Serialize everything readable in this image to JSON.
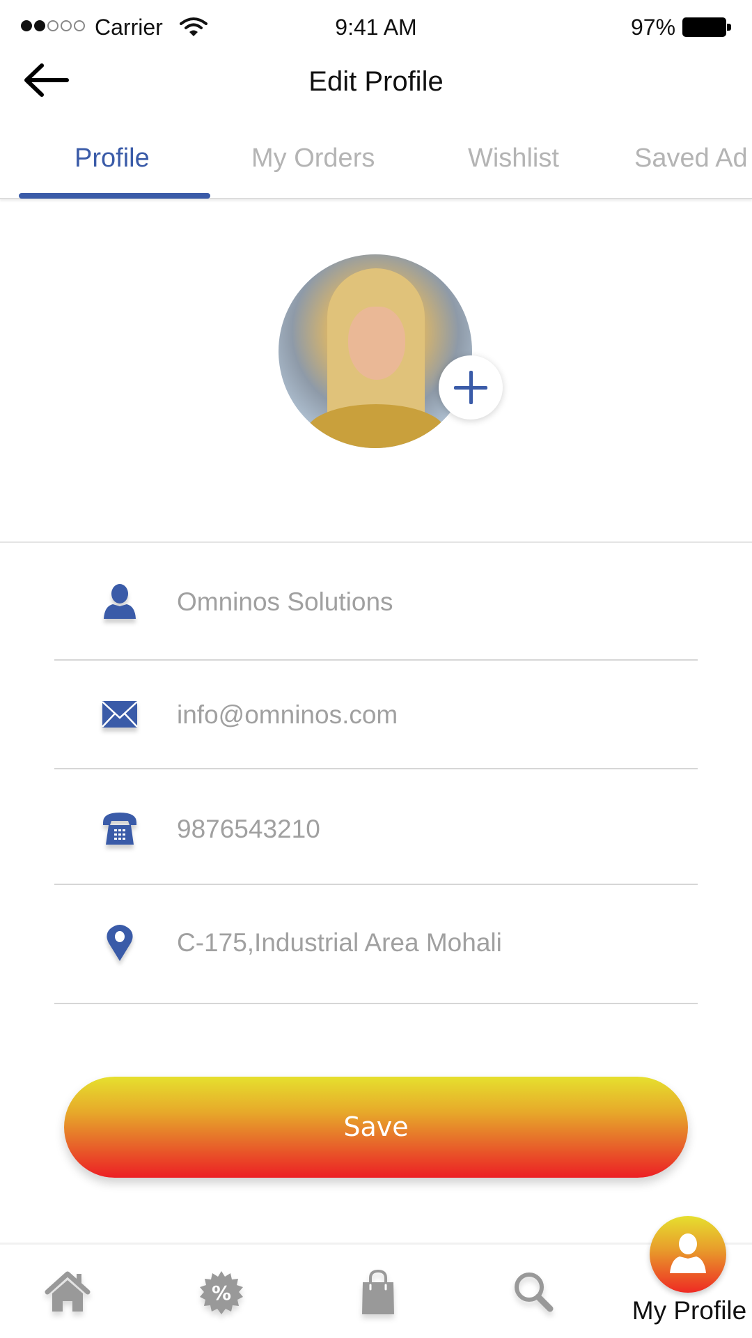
{
  "status_bar": {
    "carrier": "Carrier",
    "signal_bars_filled": 2,
    "signal_bars_total": 5,
    "time": "9:41 AM",
    "battery_percent": "97%"
  },
  "header": {
    "title": "Edit Profile",
    "back_icon": "arrow-left-icon"
  },
  "tabs": [
    {
      "label": "Profile",
      "active": true
    },
    {
      "label": "My Orders",
      "active": false
    },
    {
      "label": "Wishlist",
      "active": false
    },
    {
      "label": "Saved Ad",
      "active": false
    }
  ],
  "avatar": {
    "add_icon": "plus-icon"
  },
  "fields": [
    {
      "icon": "person-icon",
      "value": "Omninos Solutions"
    },
    {
      "icon": "envelope-icon",
      "value": "info@omninos.com"
    },
    {
      "icon": "telephone-icon",
      "value": "9876543210"
    },
    {
      "icon": "map-pin-icon",
      "value": "C-175,Industrial Area Mohali"
    }
  ],
  "save_button": {
    "label": "Save"
  },
  "bottom_nav": {
    "items": [
      {
        "icon": "home-icon",
        "label": ""
      },
      {
        "icon": "discount-badge-icon",
        "label": ""
      },
      {
        "icon": "shopping-bag-icon",
        "label": ""
      },
      {
        "icon": "search-icon",
        "label": ""
      },
      {
        "icon": "profile-icon",
        "label": "My Profile",
        "active": true
      }
    ]
  },
  "colors": {
    "accent_blue": "#3a5ba8",
    "inactive_tab": "#b4b4b4",
    "field_text": "#a0a0a0",
    "nav_icon": "#999999",
    "gradient_top": "#e6e02e",
    "gradient_bottom": "#ec1f24"
  }
}
